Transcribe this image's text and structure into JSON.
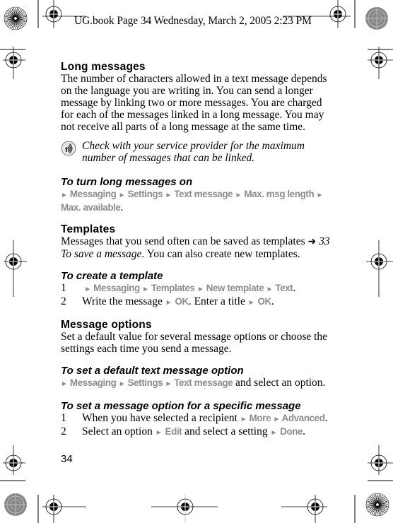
{
  "slug": {
    "text": "UG.book  Page 34  Wednesday, March 2, 2005  2:23 PM"
  },
  "sections": {
    "long_messages": {
      "heading": "Long messages",
      "body": "The number of characters allowed in a text message depends on the language you are writing in. You can send a longer message by linking two or more messages. You are charged for each of the messages linked in a long message. You may not receive all parts of a long message at the same time.",
      "lines": [
        "The number of characters allowed in a text message depends",
        "on the language you are writing in. You can send a longer",
        "message by linking two or more messages. You are charged",
        "for each of the messages linked in a long message. You may",
        "not receive all parts of a long message at the same time."
      ],
      "note": {
        "icon": "operator-note-icon",
        "lines": [
          "Check with your service provider for the maximum",
          "number of messages that can be linked."
        ]
      }
    },
    "turn_on": {
      "heading": "To turn long messages on",
      "path": [
        "Messaging",
        "Settings",
        "Text message",
        "Max. msg length",
        "Max. available"
      ],
      "terminal": "."
    },
    "templates": {
      "heading": "Templates",
      "line1": "Messages that you send often can be saved as templates",
      "ref_icon": "arrow-ref-icon",
      "ref_page": "33",
      "ref_title": "To save a message",
      "line2_rest": ". You can also create new templates."
    },
    "create_template": {
      "heading": "To create a template",
      "steps": [
        {
          "num": "1",
          "path": [
            "Messaging",
            "Templates",
            "New template",
            "Text"
          ],
          "end": "."
        },
        {
          "num": "2",
          "text_a": "Write the message",
          "key_a": "OK",
          "text_b": ". Enter a title",
          "key_b": "OK",
          "end": "."
        }
      ]
    },
    "message_options": {
      "heading": "Message options",
      "lines": [
        "Set a default value for several message options or choose the",
        "settings each time you send a message."
      ]
    },
    "default_option": {
      "heading": "To set a default text message option",
      "path": [
        "Messaging",
        "Settings",
        "Text message"
      ],
      "rest": " and select an option."
    },
    "specific_option": {
      "heading": "To set a message option for a specific message",
      "steps": [
        {
          "num": "1",
          "text": "When you have selected a recipient",
          "path": [
            "More",
            "Advanced"
          ],
          "end": "."
        },
        {
          "num": "2",
          "text_a": "Select an option",
          "key_a": "Edit",
          "text_b": " and select a setting",
          "key_b": "Done",
          "end": "."
        }
      ]
    }
  },
  "page_number": "34",
  "colors": {
    "menu_gray": "#8c8c8c",
    "text": "#000000"
  }
}
